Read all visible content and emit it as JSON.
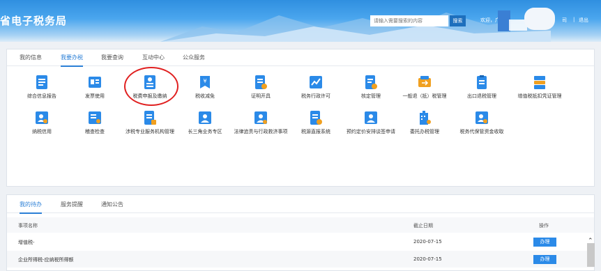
{
  "header": {
    "title": "省电子税务局",
    "search_placeholder": "请输入需要搜索的内容",
    "search_button": "搜索",
    "welcome_text": "欢迎，广",
    "link_suffix": "司",
    "separator": "|",
    "logout": "退出"
  },
  "main_tabs": [
    {
      "label": "我的信息"
    },
    {
      "label": "我要办税"
    },
    {
      "label": "我要查询"
    },
    {
      "label": "互动中心"
    },
    {
      "label": "公众服务"
    }
  ],
  "services_row1": [
    {
      "label": "综合信息报告",
      "icon": "report-icon",
      "color": "#2b8ae8"
    },
    {
      "label": "发票使用",
      "icon": "invoice-icon",
      "color": "#2b8ae8"
    },
    {
      "label": "税费申报及缴纳",
      "icon": "declare-icon",
      "color": "#2b8ae8"
    },
    {
      "label": "税收减免",
      "icon": "tax-relief-icon",
      "color": "#2b8ae8"
    },
    {
      "label": "证明开具",
      "icon": "certificate-icon",
      "color": "#2b8ae8"
    },
    {
      "label": "税务行政许可",
      "icon": "permit-chart-icon",
      "color": "#2b8ae8"
    },
    {
      "label": "核定管理",
      "icon": "approval-icon",
      "color": "#2b8ae8"
    },
    {
      "label": "一般退（抵）税管理",
      "icon": "refund-icon",
      "color": "#f0a020"
    },
    {
      "label": "出口退税管理",
      "icon": "export-refund-icon",
      "color": "#2b8ae8"
    },
    {
      "label": "增值税抵扣凭证管理",
      "icon": "vat-deduct-icon",
      "color": "#2b8ae8"
    }
  ],
  "services_row2": [
    {
      "label": "纳税信用",
      "icon": "credit-icon",
      "color": "#2b8ae8"
    },
    {
      "label": "稽查检查",
      "icon": "inspection-icon",
      "color": "#2b8ae8"
    },
    {
      "label": "涉税专业服务机构管理",
      "icon": "agency-icon",
      "color": "#2b8ae8"
    },
    {
      "label": "长三角业务专区",
      "icon": "delta-zone-icon",
      "color": "#2b8ae8"
    },
    {
      "label": "法律追责与行政救济事项",
      "icon": "legal-icon",
      "color": "#2b8ae8"
    },
    {
      "label": "税源直报系统",
      "icon": "direct-report-icon",
      "color": "#2b8ae8"
    },
    {
      "label": "预约定价安排谈签申请",
      "icon": "pricing-icon",
      "color": "#2b8ae8"
    },
    {
      "label": "委托办税管理",
      "icon": "entrust-building-icon",
      "color": "#2b8ae8"
    },
    {
      "label": "税务代保管资金收取",
      "icon": "custody-icon",
      "color": "#2b8ae8"
    }
  ],
  "bottom_tabs": [
    {
      "label": "我的待办"
    },
    {
      "label": "服务提醒"
    },
    {
      "label": "通知公告"
    }
  ],
  "todo_table": {
    "headers": {
      "name": "事项名称",
      "deadline": "截止日期",
      "action": "操作"
    },
    "rows": [
      {
        "name": "增值税-",
        "deadline": "2020-07-15",
        "action": "办理"
      },
      {
        "name": "企业所得税-应纳税所得额",
        "deadline": "2020-07-15",
        "action": "办理"
      }
    ]
  },
  "scrollbar": {
    "up_arrow": "⌃"
  }
}
